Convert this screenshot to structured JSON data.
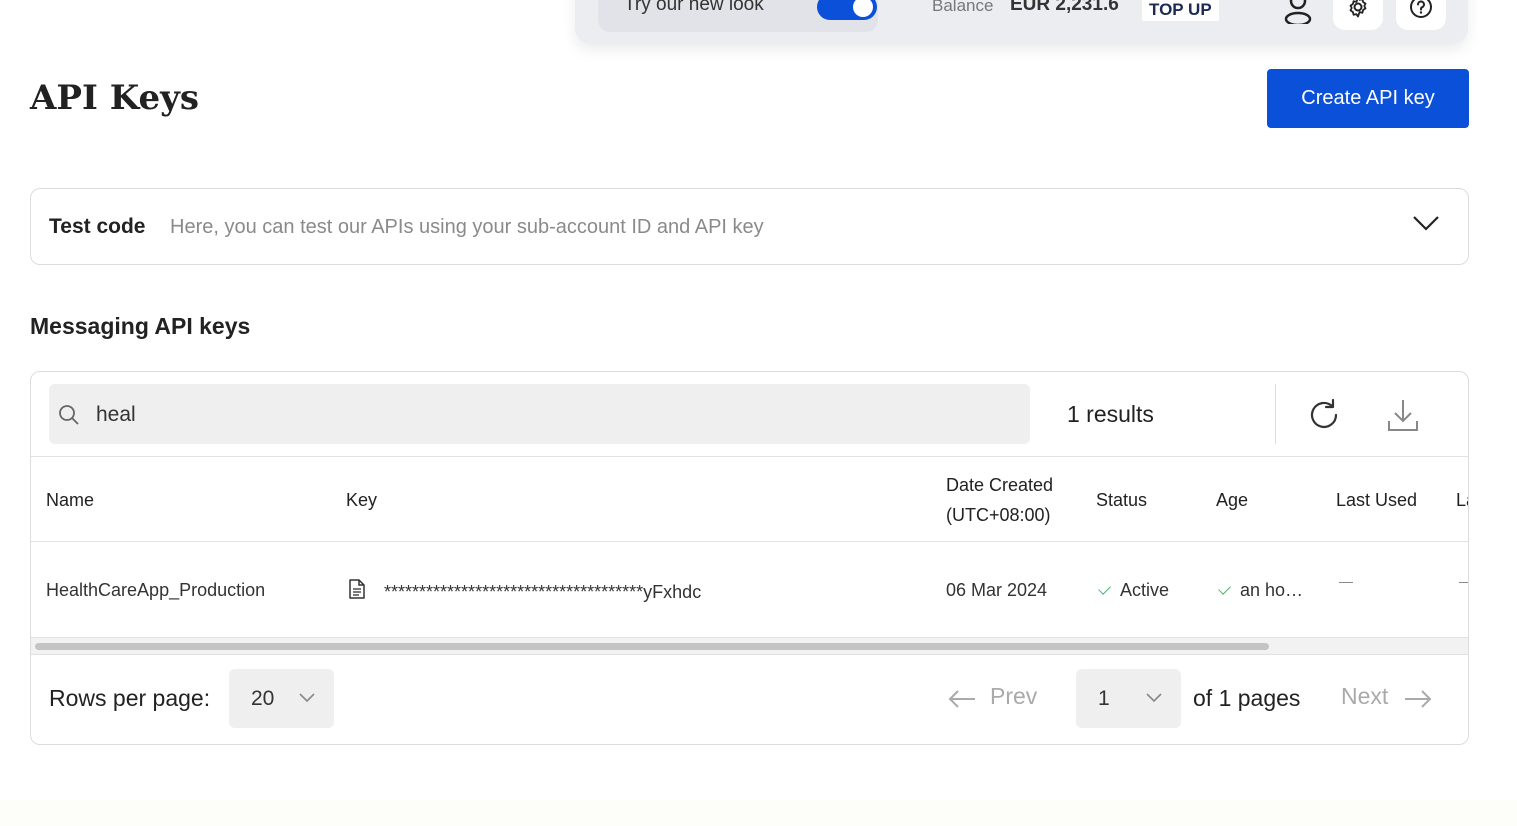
{
  "topbar": {
    "new_look_label": "Try our new look",
    "balance_label": "Balance",
    "balance_value": "EUR 2,231.6",
    "top_up_label": "TOP UP"
  },
  "page": {
    "title": "API Keys",
    "create_button_label": "Create API key"
  },
  "test_code": {
    "title": "Test code",
    "description": "Here, you can test our APIs using your sub-account ID and API key"
  },
  "section": {
    "title": "Messaging API keys"
  },
  "toolbar": {
    "search_value": "heal",
    "results_text": "1 results"
  },
  "table": {
    "columns": {
      "name": "Name",
      "key": "Key",
      "date_created_line1": "Date Created",
      "date_created_line2": "(UTC+08:00)",
      "status": "Status",
      "age": "Age",
      "last_used": "Last Used",
      "next_col": "La"
    },
    "rows": [
      {
        "name": "HealthCareApp_Production",
        "key": "*************************************yFxhdc",
        "date_created": "06 Mar 2024",
        "status": "Active",
        "age": "an ho…"
      }
    ]
  },
  "pagination": {
    "rows_per_page_label": "Rows per page:",
    "rows_per_page_value": "20",
    "prev_label": "Prev",
    "page_value": "1",
    "of_pages_text": "of 1 pages",
    "next_label": "Next"
  },
  "colors": {
    "accent": "#0b50d9",
    "status_ok": "#46b96e"
  }
}
